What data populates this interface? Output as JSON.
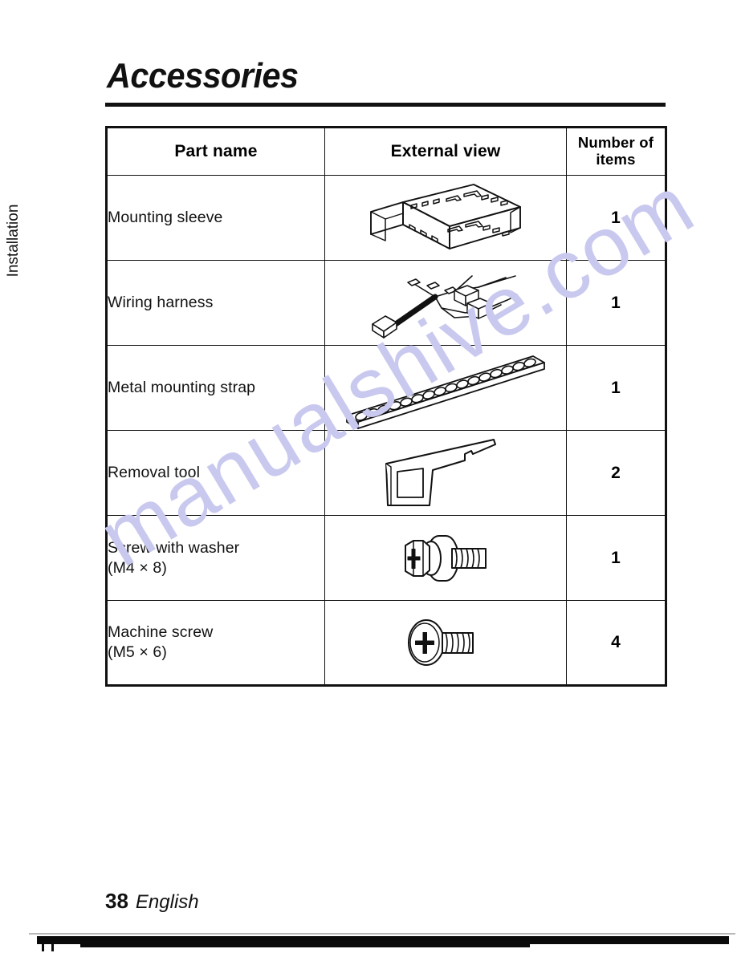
{
  "page": {
    "title": "Accessories",
    "side_tab_label": "Installation",
    "footer_page_number": "38",
    "footer_language": "English",
    "watermark_text": "manualshive.com",
    "watermark_color": "#c9c9ef"
  },
  "table": {
    "headers": {
      "part_name": "Part name",
      "external_view": "External view",
      "number_of_items_line1": "Number of",
      "number_of_items_line2": "items"
    },
    "rows": [
      {
        "part_name": "Mounting sleeve",
        "part_name_sub": "",
        "illustration": "mounting-sleeve-illustration",
        "quantity": "1"
      },
      {
        "part_name": "Wiring harness",
        "part_name_sub": "",
        "illustration": "wiring-harness-illustration",
        "quantity": "1"
      },
      {
        "part_name": "Metal mounting strap",
        "part_name_sub": "",
        "illustration": "metal-mounting-strap-illustration",
        "quantity": "1"
      },
      {
        "part_name": "Removal tool",
        "part_name_sub": "",
        "illustration": "removal-tool-illustration",
        "quantity": "2"
      },
      {
        "part_name": "Screw with washer",
        "part_name_sub": "(M4 × 8)",
        "illustration": "screw-with-washer-illustration",
        "quantity": "1"
      },
      {
        "part_name": "Machine screw",
        "part_name_sub": "(M5 × 6)",
        "illustration": "machine-screw-illustration",
        "quantity": "4"
      }
    ]
  }
}
